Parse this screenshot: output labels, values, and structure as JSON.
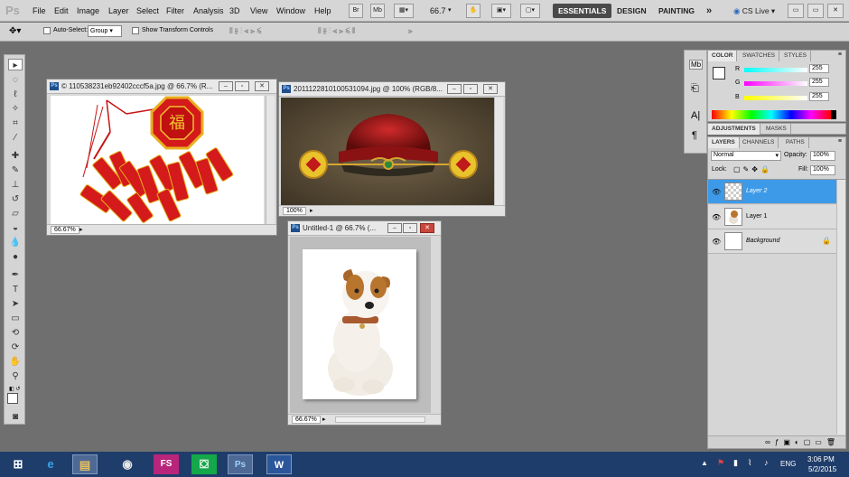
{
  "app": {
    "logo": "Ps"
  },
  "menu": [
    "File",
    "Edit",
    "Image",
    "Layer",
    "Select",
    "Filter",
    "Analysis",
    "3D",
    "View",
    "Window",
    "Help"
  ],
  "toolbar": {
    "br": "Br",
    "mb": "Mb",
    "zoom": "66.7"
  },
  "workspaces": {
    "essentials": "ESSENTIALS",
    "design": "DESIGN",
    "painting": "PAINTING",
    "more": "»",
    "cslive": "CS Live"
  },
  "options": {
    "auto_select_label": "Auto-Select:",
    "auto_select_value": "Group",
    "show_transform": "Show Transform Controls"
  },
  "docs": [
    {
      "title": "© 110538231eb92402cccf5a.jpg @ 66.7% (R...",
      "zoom": "66.67%"
    },
    {
      "title": "2011122810100531094.jpg @ 100% (RGB/8...",
      "zoom": "100%"
    },
    {
      "title": "Untitled-1 @ 66.7% (...",
      "zoom": "66.67%"
    }
  ],
  "color_panel": {
    "tabs": [
      "COLOR",
      "SWATCHES",
      "STYLES"
    ],
    "r_label": "R",
    "g_label": "G",
    "b_label": "B",
    "r": "255",
    "g": "255",
    "b": "255"
  },
  "adjust_panel": {
    "tabs": [
      "ADJUSTMENTS",
      "MASKS"
    ]
  },
  "layers_panel": {
    "tabs": [
      "LAYERS",
      "CHANNELS",
      "PATHS"
    ],
    "blend": "Normal",
    "opacity_label": "Opacity:",
    "opacity": "100%",
    "lock_label": "Lock:",
    "fill_label": "Fill:",
    "fill": "100%",
    "layers": [
      {
        "name": "Layer 2",
        "selected": true
      },
      {
        "name": "Layer 1",
        "selected": false
      },
      {
        "name": "Background",
        "selected": false
      }
    ]
  },
  "taskbar": {
    "lang": "ENG",
    "time": "3:06 PM",
    "date": "5/2/2015",
    "fs": "FS",
    "ps": "Ps",
    "word": "W"
  }
}
